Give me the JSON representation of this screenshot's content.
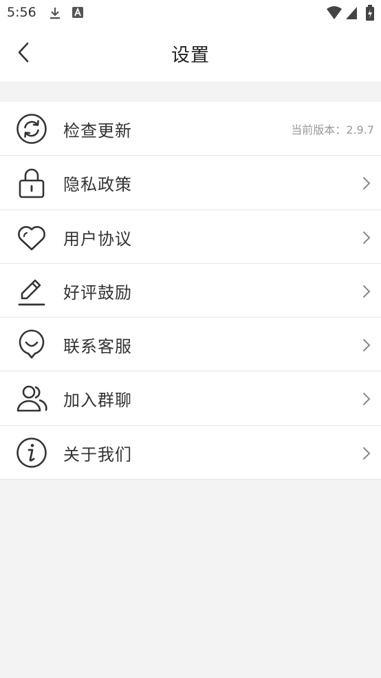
{
  "status_bar": {
    "time": "5:56",
    "icons": [
      "download-icon",
      "a-notification-icon",
      "wifi-icon",
      "cell-signal-icon",
      "battery-icon"
    ]
  },
  "header": {
    "title": "设置",
    "back_icon": "back-arrow-icon"
  },
  "settings": {
    "items": [
      {
        "icon": "refresh-icon",
        "label": "检查更新",
        "meta": "当前版本：2.9.7"
      },
      {
        "icon": "lock-icon",
        "label": "隐私政策",
        "meta": ""
      },
      {
        "icon": "heart-icon",
        "label": "用户协议",
        "meta": ""
      },
      {
        "icon": "pen-icon",
        "label": "好评鼓励",
        "meta": ""
      },
      {
        "icon": "customer-service-icon",
        "label": "联系客服",
        "meta": ""
      },
      {
        "icon": "group-icon",
        "label": "加入群聊",
        "meta": ""
      },
      {
        "icon": "info-icon",
        "label": "关于我们",
        "meta": ""
      }
    ]
  },
  "colors": {
    "background": "#f3f3f3",
    "surface": "#ffffff",
    "text": "#333333",
    "muted": "#999999",
    "divider": "#e6e6e6"
  }
}
